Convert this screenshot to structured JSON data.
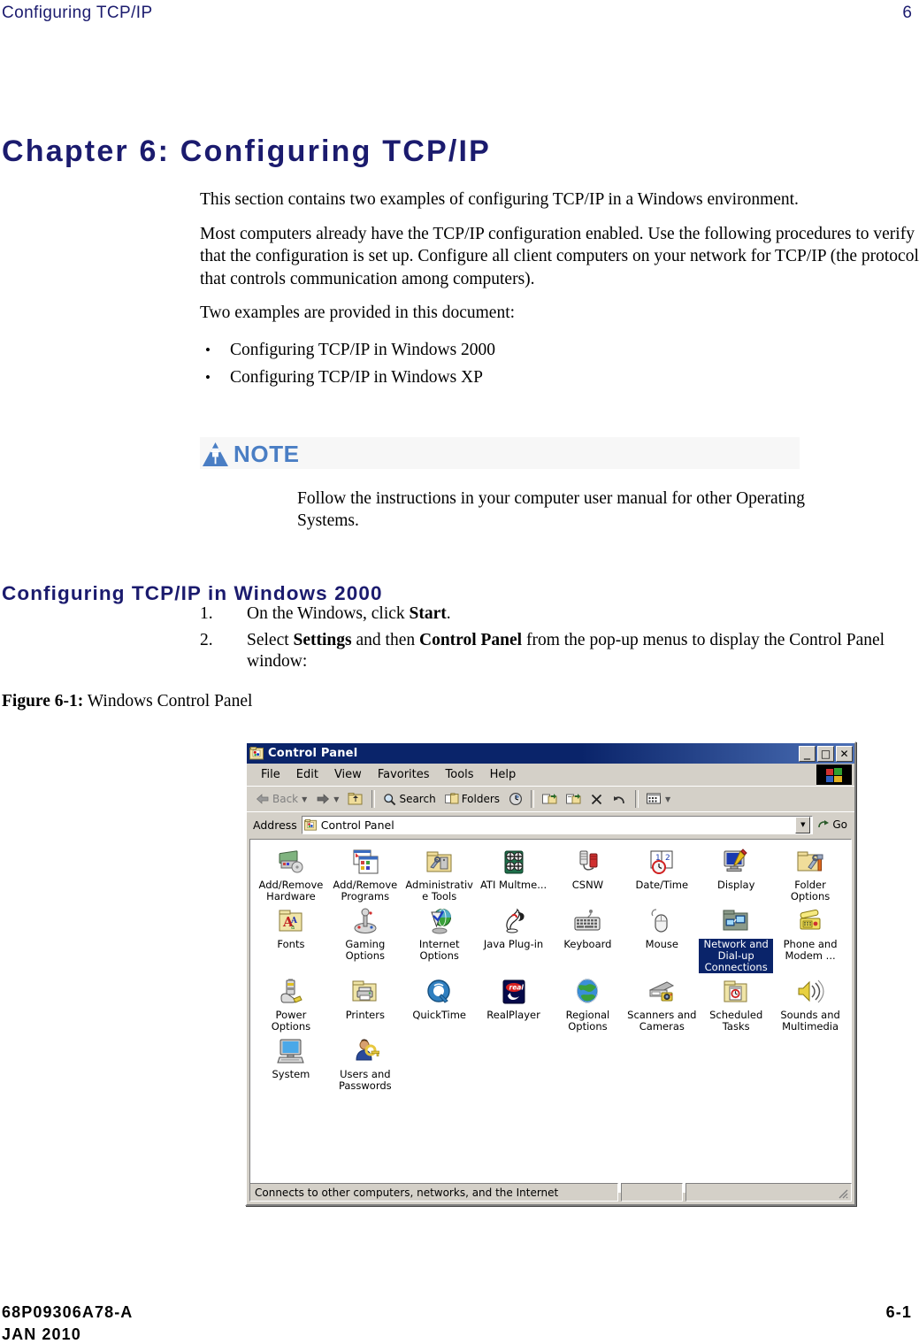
{
  "header": {
    "title": "Configuring TCP/IP",
    "page_number": "6"
  },
  "chapter_title": "Chapter 6:  Configuring TCP/IP",
  "intro": {
    "para1": "This section contains two examples of configuring TCP/IP in a Windows environment.",
    "para2": "Most computers already have the TCP/IP configuration enabled. Use the following procedures to verify that the configuration is set up. Configure all client computers on your network for TCP/IP (the protocol that controls communication among computers).",
    "para3": "Two examples are provided in this document:",
    "bullets": [
      "Configuring TCP/IP in Windows 2000",
      "Configuring TCP/IP in Windows XP"
    ],
    "bullet_char": "•"
  },
  "note": {
    "label": "NOTE",
    "body": "Follow the instructions in your computer user manual for other Operating Systems.",
    "accent_color": "#4a7ec4"
  },
  "section": {
    "heading": "Configuring TCP/IP in Windows 2000",
    "steps": [
      {
        "number": "1.",
        "parts": [
          {
            "text": "On the Windows, click ",
            "bold": false
          },
          {
            "text": "Start",
            "bold": true
          },
          {
            "text": ".",
            "bold": false
          }
        ]
      },
      {
        "number": "2.",
        "parts": [
          {
            "text": "Select ",
            "bold": false
          },
          {
            "text": "Settings",
            "bold": true
          },
          {
            "text": " and then ",
            "bold": false
          },
          {
            "text": "Control Panel",
            "bold": true
          },
          {
            "text": " from the pop-up menus to display the Control Panel window:",
            "bold": false
          }
        ]
      }
    ]
  },
  "figure": {
    "label": "Figure 6-1:",
    "caption": "Windows Control Panel"
  },
  "control_panel": {
    "title": "Control Panel",
    "title_icon": "control-panel-folder-icon",
    "window_buttons": [
      {
        "name": "minimize",
        "glyph": "_"
      },
      {
        "name": "maximize",
        "glyph": "□"
      },
      {
        "name": "close",
        "glyph": "✕"
      }
    ],
    "menus": [
      {
        "label": "File",
        "accel": "F"
      },
      {
        "label": "Edit",
        "accel": "E"
      },
      {
        "label": "View",
        "accel": "V"
      },
      {
        "label": "Favorites",
        "accel": "a"
      },
      {
        "label": "Tools",
        "accel": "T"
      },
      {
        "label": "Help",
        "accel": "H"
      }
    ],
    "toolbar": [
      {
        "label": "Back",
        "icon": "back-arrow-icon",
        "disabled": true,
        "dropdown": true
      },
      {
        "label": "",
        "icon": "forward-arrow-icon",
        "disabled": true,
        "dropdown": true
      },
      {
        "label": "",
        "icon": "up-folder-icon",
        "disabled": false,
        "dropdown": false
      },
      {
        "label": "Search",
        "icon": "search-icon",
        "disabled": false,
        "dropdown": false
      },
      {
        "label": "Folders",
        "icon": "folders-icon",
        "disabled": false,
        "dropdown": false
      },
      {
        "label": "",
        "icon": "history-clock-icon",
        "disabled": false,
        "dropdown": false
      },
      {
        "label": "",
        "icon": "move-to-icon",
        "disabled": false,
        "dropdown": false
      },
      {
        "label": "",
        "icon": "copy-to-icon",
        "disabled": false,
        "dropdown": false
      },
      {
        "label": "",
        "icon": "delete-x-icon",
        "disabled": false,
        "dropdown": false
      },
      {
        "label": "",
        "icon": "undo-icon",
        "disabled": false,
        "dropdown": false
      },
      {
        "label": "",
        "icon": "views-icon",
        "disabled": false,
        "dropdown": true
      }
    ],
    "address": {
      "label": "Address",
      "value": "Control Panel",
      "icon": "control-panel-folder-icon",
      "go_label": "Go"
    },
    "items": [
      {
        "label": "Add/Remove Hardware",
        "icon": "add-remove-hardware-icon",
        "selected": false
      },
      {
        "label": "Add/Remove Programs",
        "icon": "add-remove-programs-icon",
        "selected": false
      },
      {
        "label": "Administrative Tools",
        "icon": "administrative-tools-icon",
        "selected": false
      },
      {
        "label": "ATI Multme...",
        "icon": "ati-multimedia-icon",
        "selected": false
      },
      {
        "label": "CSNW",
        "icon": "csnw-icon",
        "selected": false
      },
      {
        "label": "Date/Time",
        "icon": "date-time-icon",
        "selected": false
      },
      {
        "label": "Display",
        "icon": "display-icon",
        "selected": false
      },
      {
        "label": "Folder Options",
        "icon": "folder-options-icon",
        "selected": false
      },
      {
        "label": "Fonts",
        "icon": "fonts-icon",
        "selected": false
      },
      {
        "label": "Gaming Options",
        "icon": "gaming-options-icon",
        "selected": false
      },
      {
        "label": "Internet Options",
        "icon": "internet-options-icon",
        "selected": false
      },
      {
        "label": "Java Plug-in",
        "icon": "java-plugin-icon",
        "selected": false
      },
      {
        "label": "Keyboard",
        "icon": "keyboard-icon",
        "selected": false
      },
      {
        "label": "Mouse",
        "icon": "mouse-icon",
        "selected": false
      },
      {
        "label": "Network and Dial-up Connections",
        "icon": "network-dialup-connections-icon",
        "selected": true
      },
      {
        "label": "Phone and Modem ...",
        "icon": "phone-modem-icon",
        "selected": false
      },
      {
        "label": "Power Options",
        "icon": "power-options-icon",
        "selected": false
      },
      {
        "label": "Printers",
        "icon": "printers-icon",
        "selected": false
      },
      {
        "label": "QuickTime",
        "icon": "quicktime-icon",
        "selected": false
      },
      {
        "label": "RealPlayer",
        "icon": "realplayer-icon",
        "selected": false
      },
      {
        "label": "Regional Options",
        "icon": "regional-options-icon",
        "selected": false
      },
      {
        "label": "Scanners and Cameras",
        "icon": "scanners-cameras-icon",
        "selected": false
      },
      {
        "label": "Scheduled Tasks",
        "icon": "scheduled-tasks-icon",
        "selected": false
      },
      {
        "label": "Sounds and Multimedia",
        "icon": "sounds-multimedia-icon",
        "selected": false
      },
      {
        "label": "System",
        "icon": "system-icon",
        "selected": false
      },
      {
        "label": "Users and Passwords",
        "icon": "users-passwords-icon",
        "selected": false
      }
    ],
    "status_bar": {
      "pane1": "Connects to other computers, networks, and the Internet",
      "pane2": "",
      "pane3": ""
    },
    "selection_color": "#0a246a",
    "chrome_color": "#d4d0c8"
  },
  "footer": {
    "part_number": "68P09306A78-A",
    "date": "JAN 2010",
    "page": "6-1"
  }
}
